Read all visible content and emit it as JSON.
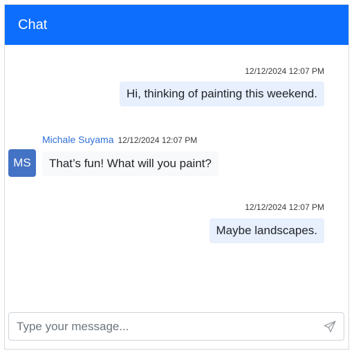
{
  "header": {
    "title": "Chat"
  },
  "messages": [
    {
      "direction": "outgoing",
      "timestamp": "12/12/2024 12:07 PM",
      "text": "Hi, thinking of painting this weekend."
    },
    {
      "direction": "incoming",
      "sender": "Michale Suyama",
      "initials": "MS",
      "timestamp": "12/12/2024 12:07 PM",
      "text": "That’s fun! What will you paint?"
    },
    {
      "direction": "outgoing",
      "timestamp": "12/12/2024 12:07 PM",
      "text": "Maybe landscapes."
    }
  ],
  "composer": {
    "placeholder": "Type your message...",
    "value": "",
    "send_icon": "send-icon"
  },
  "colors": {
    "header": "#0d6efd",
    "outgoing_bubble": "#e8effd",
    "incoming_bubble": "#f8f9fa",
    "avatar": "#4472c4",
    "sender_name": "#2f6fd8"
  }
}
